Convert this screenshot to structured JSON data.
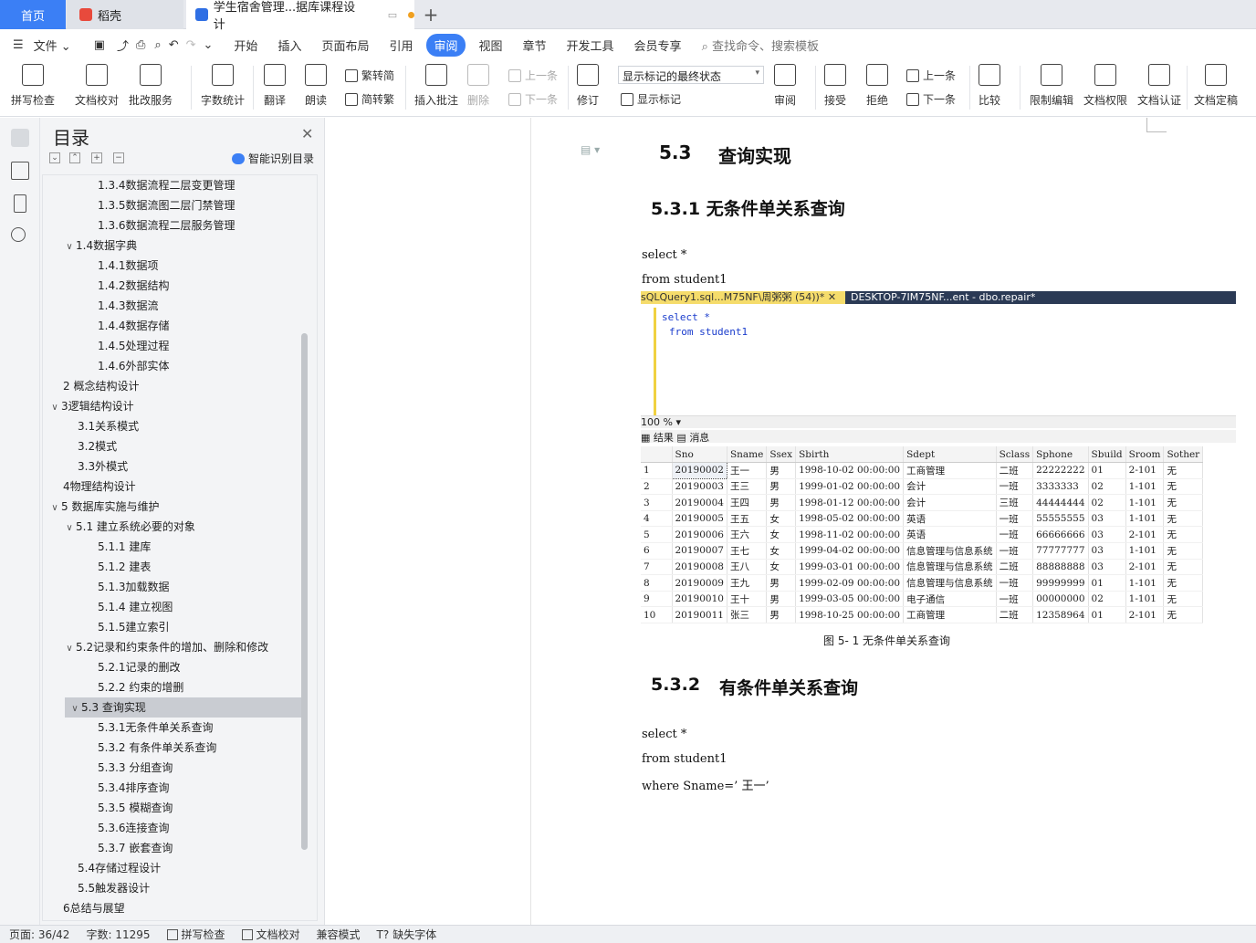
{
  "tabs": {
    "home": "首页",
    "daoke": "稻壳",
    "doc": "学生宿舍管理...据库课程设计"
  },
  "menu": {
    "file": "文件",
    "items": [
      "开始",
      "插入",
      "页面布局",
      "引用",
      "审阅",
      "视图",
      "章节",
      "开发工具",
      "会员专享"
    ],
    "active": "审阅",
    "search": "查找命令、搜索模板"
  },
  "ribbon": {
    "spell": "拼写检查",
    "proof": "文档校对",
    "revise_service": "批改服务",
    "wordcount": "字数统计",
    "translate": "翻译",
    "read": "朗读",
    "to_trad": "繁转简",
    "to_simp": "简转繁",
    "insert_comment": "插入批注",
    "delete": "删除",
    "prev_c": "上一条",
    "next_c": "下一条",
    "track": "修订",
    "status_select": "显示标记的最终状态",
    "show_markup": "显示标记",
    "review": "审阅",
    "accept": "接受",
    "reject": "拒绝",
    "prev": "上一条",
    "next": "下一条",
    "compare": "比较",
    "restrict": "限制编辑",
    "rights": "文档权限",
    "certify": "文档认证",
    "finalize": "文档定稿"
  },
  "toc": {
    "title": "目录",
    "smart": "智能识别目录",
    "items": [
      {
        "label": "1.3.4数据流程二层变更管理",
        "level": 3
      },
      {
        "label": "1.3.5数据流图二层门禁管理",
        "level": 3
      },
      {
        "label": "1.3.6数据流程二层服务管理",
        "level": 3
      },
      {
        "label": "1.4数据字典",
        "level": 2,
        "chev": "v"
      },
      {
        "label": "1.4.1数据项",
        "level": 3
      },
      {
        "label": "1.4.2数据结构",
        "level": 3
      },
      {
        "label": "1.4.3数据流",
        "level": 3
      },
      {
        "label": "1.4.4数据存储",
        "level": 3
      },
      {
        "label": "1.4.5处理过程",
        "level": 3
      },
      {
        "label": "1.4.6外部实体",
        "level": 3
      },
      {
        "label": "2 概念结构设计",
        "level": 1
      },
      {
        "label": "3逻辑结构设计",
        "level": 1,
        "chev": "v"
      },
      {
        "label": "3.1关系模式",
        "level": 2
      },
      {
        "label": "3.2模式",
        "level": 2
      },
      {
        "label": "3.3外模式",
        "level": 2
      },
      {
        "label": "4物理结构设计",
        "level": 1
      },
      {
        "label": "5 数据库实施与维护",
        "level": 1,
        "chev": "v"
      },
      {
        "label": "5.1 建立系统必要的对象",
        "level": 2,
        "chev": "v"
      },
      {
        "label": "5.1.1 建库",
        "level": 3
      },
      {
        "label": "5.1.2 建表",
        "level": 3
      },
      {
        "label": "5.1.3加载数据",
        "level": 3
      },
      {
        "label": "5.1.4 建立视图",
        "level": 3
      },
      {
        "label": "5.1.5建立索引",
        "level": 3
      },
      {
        "label": "5.2记录和约束条件的增加、删除和修改",
        "level": 2,
        "chev": "v"
      },
      {
        "label": "5.2.1记录的删改",
        "level": 3
      },
      {
        "label": "5.2.2 约束的增删",
        "level": 3
      },
      {
        "label": "5.3 查询实现",
        "level": 2,
        "chev": "v",
        "selected": true
      },
      {
        "label": "5.3.1无条件单关系查询",
        "level": 3
      },
      {
        "label": "5.3.2 有条件单关系查询",
        "level": 3
      },
      {
        "label": "5.3.3 分组查询",
        "level": 3
      },
      {
        "label": "5.3.4排序查询",
        "level": 3
      },
      {
        "label": "5.3.5 模糊查询",
        "level": 3
      },
      {
        "label": "5.3.6连接查询",
        "level": 3
      },
      {
        "label": "5.3.7 嵌套查询",
        "level": 3
      },
      {
        "label": "5.4存储过程设计",
        "level": 2
      },
      {
        "label": "5.5触发器设计",
        "level": 2
      },
      {
        "label": "6总结与展望",
        "level": 1
      }
    ]
  },
  "doc": {
    "h53_num": "5.3",
    "h53": "查询实现",
    "h531": "5.3.1 无条件单关系查询",
    "code1a": "select *",
    "code1b": "from student1",
    "shot": {
      "tab1": "sQLQuery1.sql...M75NF\\周粥粥 (54))*",
      "tab2": "DESKTOP-7IM75NF...ent - dbo.repair*",
      "ed1": "select *",
      "ed2": "from student1",
      "zoom": "100 %",
      "results": "结果",
      "messages": "消息",
      "columns": [
        "Sno",
        "Sname",
        "Ssex",
        "Sbirth",
        "Sdept",
        "Sclass",
        "Sphone",
        "Sbuild",
        "Sroom",
        "Sother"
      ],
      "rows": [
        [
          "1",
          "20190002",
          "王一",
          "男",
          "1998-10-02 00:00:00",
          "工商管理",
          "二班",
          "22222222",
          "01",
          "2-101",
          "无"
        ],
        [
          "2",
          "20190003",
          "王三",
          "男",
          "1999-01-02 00:00:00",
          "会计",
          "一班",
          "3333333",
          "02",
          "1-101",
          "无"
        ],
        [
          "3",
          "20190004",
          "王四",
          "男",
          "1998-01-12 00:00:00",
          "会计",
          "三班",
          "44444444",
          "02",
          "1-101",
          "无"
        ],
        [
          "4",
          "20190005",
          "王五",
          "女",
          "1998-05-02 00:00:00",
          "英语",
          "一班",
          "55555555",
          "03",
          "1-101",
          "无"
        ],
        [
          "5",
          "20190006",
          "王六",
          "女",
          "1998-11-02 00:00:00",
          "英语",
          "一班",
          "66666666",
          "03",
          "2-101",
          "无"
        ],
        [
          "6",
          "20190007",
          "王七",
          "女",
          "1999-04-02 00:00:00",
          "信息管理与信息系统",
          "一班",
          "77777777",
          "03",
          "1-101",
          "无"
        ],
        [
          "7",
          "20190008",
          "王八",
          "女",
          "1999-03-01 00:00:00",
          "信息管理与信息系统",
          "二班",
          "88888888",
          "03",
          "2-101",
          "无"
        ],
        [
          "8",
          "20190009",
          "王九",
          "男",
          "1999-02-09 00:00:00",
          "信息管理与信息系统",
          "一班",
          "99999999",
          "01",
          "1-101",
          "无"
        ],
        [
          "9",
          "20190010",
          "王十",
          "男",
          "1999-03-05 00:00:00",
          "电子通信",
          "一班",
          "00000000",
          "02",
          "1-101",
          "无"
        ],
        [
          "10",
          "20190011",
          "张三",
          "男",
          "1998-10-25 00:00:00",
          "工商管理",
          "二班",
          "12358964",
          "01",
          "2-101",
          "无"
        ]
      ]
    },
    "caption": "图 5- 1 无条件单关系查询",
    "h532_num": "5.3.2",
    "h532": "有条件单关系查询",
    "code2a": "select *",
    "code2b": "from student1",
    "code2c": "where Sname=’ 王一’"
  },
  "status": {
    "page": "页面: 36/42",
    "words": "字数: 11295",
    "spell": "拼写检查",
    "proof": "文档校对",
    "compat": "兼容模式",
    "missing_font": "缺失字体"
  },
  "colors": {
    "accent": "#3b7ff5",
    "highlight_tab": "#f5dc6b",
    "ssms_tabbar": "#2b3a55"
  }
}
